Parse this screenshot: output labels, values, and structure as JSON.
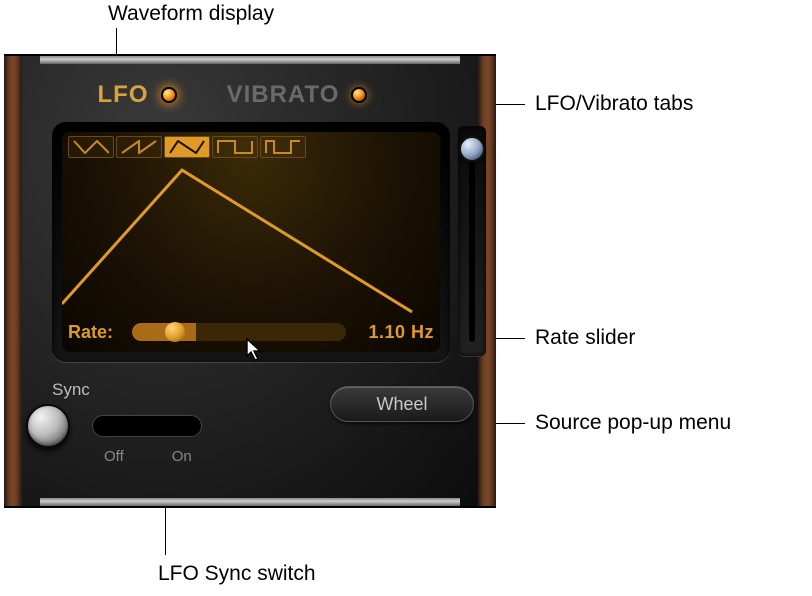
{
  "callouts": {
    "waveform": "Waveform display",
    "tabs": "LFO/Vibrato tabs",
    "rate": "Rate slider",
    "source": "Source pop-up menu",
    "sync": "LFO Sync switch"
  },
  "tabs": {
    "lfo": "LFO",
    "vibrato": "VIBRATO"
  },
  "rate": {
    "label": "Rate:",
    "value": "1.10 Hz"
  },
  "sync": {
    "title": "Sync",
    "off": "Off",
    "on": "On"
  },
  "source": {
    "selected": "Wheel"
  },
  "waveform_shapes": [
    "tri-down",
    "ramp-up",
    "triangle",
    "square",
    "pulse"
  ],
  "colors": {
    "accent": "#e09a28"
  }
}
